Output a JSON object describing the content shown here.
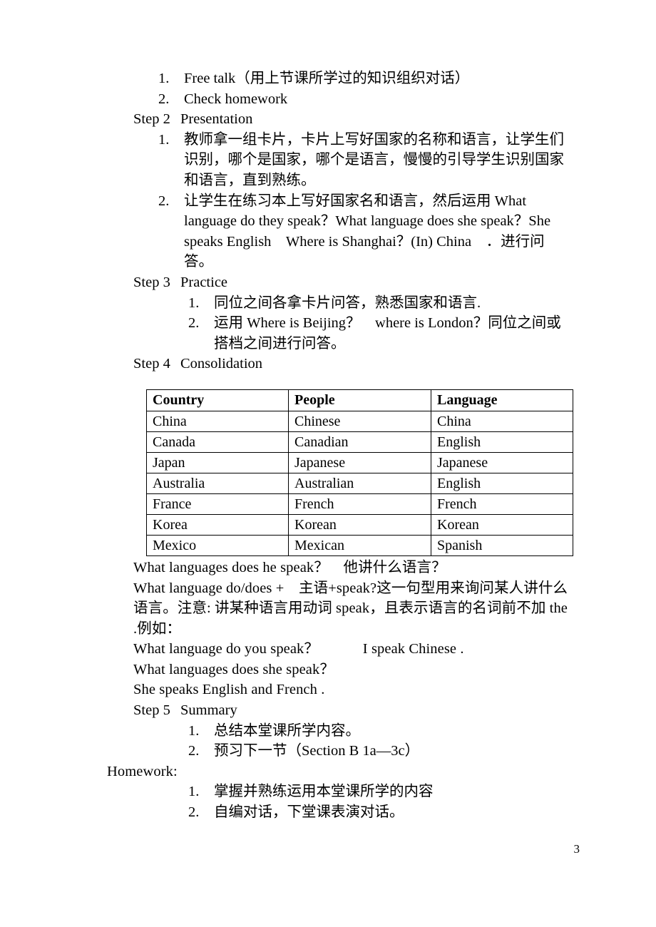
{
  "document": {
    "page_number": "3",
    "top_list": [
      {
        "marker": "1.",
        "text": "Free talk（用上节课所学过的知识组织对话）"
      },
      {
        "marker": "2.",
        "text": "Check homework"
      }
    ],
    "step2": {
      "label": "Step 2",
      "title": "Presentation",
      "items": [
        {
          "marker": "1.",
          "text": "教师拿一组卡片，卡片上写好国家的名称和语言，让学生们识别，哪个是国家，哪个是语言，慢慢的引导学生识别国家和语言，直到熟练。"
        },
        {
          "marker": "2.",
          "text": "让学生在练习本上写好国家名和语言，然后运用 What language do they speak？What language does she speak？She speaks English　Where is Shanghai？(In) China　．进行问答。"
        }
      ]
    },
    "step3": {
      "label": "Step 3",
      "title": "Practice",
      "items": [
        {
          "marker": "1.",
          "text": "同位之间各拿卡片问答，熟悉国家和语言."
        },
        {
          "marker": "2.",
          "text": "运用 Where is Beijing？　where is London？同位之间或搭档之间进行问答。"
        }
      ]
    },
    "step4": {
      "label": "Step 4",
      "title": "Consolidation"
    },
    "table": {
      "headers": [
        "Country",
        "People",
        "Language"
      ],
      "rows": [
        [
          "China",
          "Chinese",
          "China"
        ],
        [
          "Canada",
          "Canadian",
          "English"
        ],
        [
          "Japan",
          "Japanese",
          "Japanese"
        ],
        [
          "Australia",
          "Australian",
          "English"
        ],
        [
          "France",
          "French",
          "French"
        ],
        [
          "Korea",
          "Korean",
          "Korean"
        ],
        [
          "Mexico",
          "Mexican",
          "Spanish"
        ]
      ]
    },
    "notes": [
      "What languages does he speak？　他讲什么语言？",
      "What language do/does +　主语+speak?这一句型用来询问某人讲什么语言。注意: 讲某种语言用动词 speak，且表示语言的名词前不加 the .例如：",
      "What language do you speak？　　　I speak Chinese .",
      "What languages does she speak？",
      "She speaks English and French ."
    ],
    "step5": {
      "label": "Step 5",
      "title": "Summary",
      "items": [
        {
          "marker": "1.",
          "text": "总结本堂课所学内容。"
        },
        {
          "marker": "2.",
          "text": "预习下一节（Section B 1a—3c）"
        }
      ]
    },
    "homework": {
      "label": "Homework:",
      "items": [
        {
          "marker": "1.",
          "text": "掌握并熟练运用本堂课所学的内容"
        },
        {
          "marker": "2.",
          "text": "自编对话，下堂课表演对话。"
        }
      ]
    }
  }
}
